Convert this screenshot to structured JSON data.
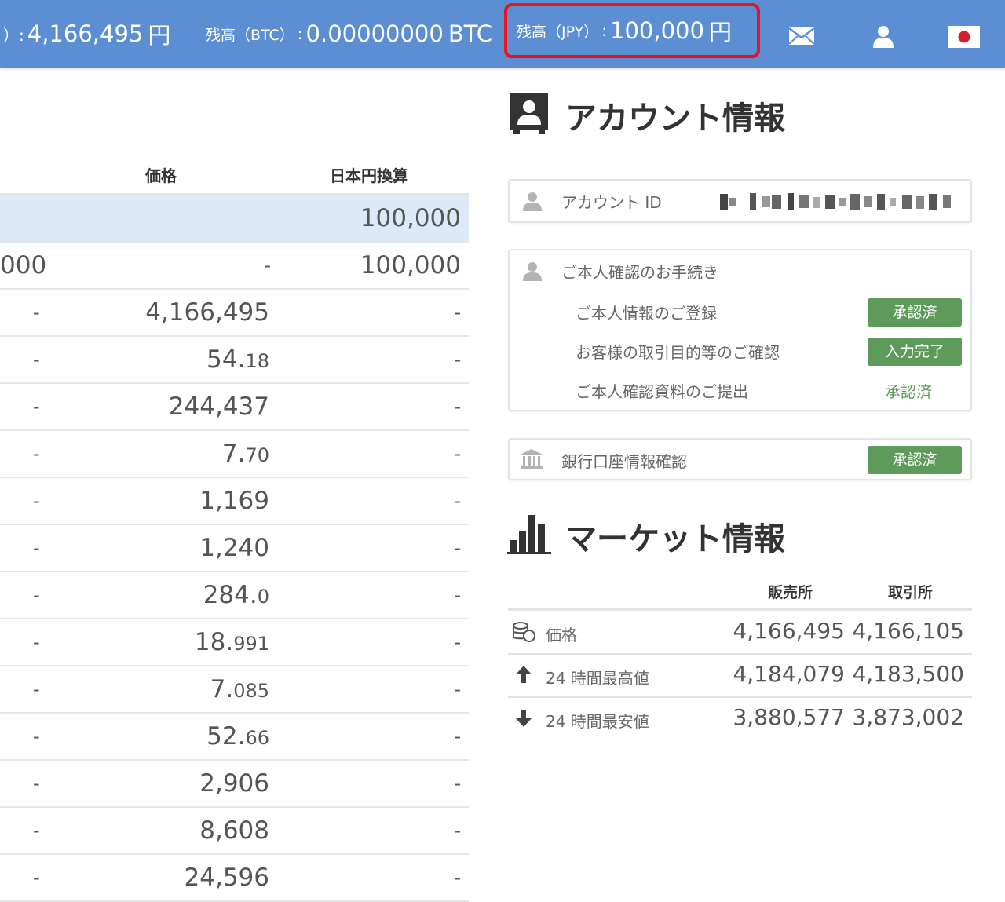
{
  "topbar": {
    "partial_prefix": "）:",
    "partial_value": "4,166,495",
    "partial_unit": "円",
    "btc_label": "残高（BTC）",
    "btc_sep": ":",
    "btc_value": "0.00000000",
    "btc_unit": "BTC",
    "jpy_label": "残高（JPY）",
    "jpy_sep": ":",
    "jpy_value": "100,000",
    "jpy_unit": "円",
    "icons": [
      "mail-icon",
      "user-icon",
      "japan-flag-icon"
    ],
    "highlight_color": "#e8131f",
    "bar_color": "#5b8ed3"
  },
  "table": {
    "headers": {
      "price": "価格",
      "jpy": "日本円換算"
    },
    "rows": [
      {
        "amount": "",
        "price": "",
        "jpy": "100,000"
      },
      {
        "amount": "000",
        "price": "-",
        "jpy": "100,000"
      },
      {
        "amount": "-",
        "price": "4,166,495",
        "jpy": "-"
      },
      {
        "amount": "-",
        "price_main": "54.",
        "price_small": "18",
        "jpy": "-"
      },
      {
        "amount": "-",
        "price": "244,437",
        "jpy": "-"
      },
      {
        "amount": "-",
        "price_main": "7.",
        "price_small": "70",
        "jpy": "-"
      },
      {
        "amount": "-",
        "price": "1,169",
        "jpy": "-"
      },
      {
        "amount": "-",
        "price": "1,240",
        "jpy": "-"
      },
      {
        "amount": "-",
        "price_main": "284.",
        "price_small": "0",
        "jpy": "-"
      },
      {
        "amount": "-",
        "price_main": "18.",
        "price_small": "991",
        "jpy": "-"
      },
      {
        "amount": "-",
        "price_main": "7.",
        "price_small": "085",
        "jpy": "-"
      },
      {
        "amount": "-",
        "price_main": "52.",
        "price_small": "66",
        "jpy": "-"
      },
      {
        "amount": "-",
        "price": "2,906",
        "jpy": "-"
      },
      {
        "amount": "-",
        "price": "8,608",
        "jpy": "-"
      },
      {
        "amount": "-",
        "price": "24,596",
        "jpy": "-"
      }
    ]
  },
  "account": {
    "title": "アカウント情報",
    "id_label": "アカウント ID",
    "identity": {
      "title": "ご本人確認のお手続き",
      "items": [
        {
          "label": "ご本人情報のご登録",
          "status": "承認済"
        },
        {
          "label": "お客様の取引目的等のご確認",
          "status": "入力完了"
        },
        {
          "label": "ご本人確認資料のご提出",
          "status": "承認済"
        }
      ]
    },
    "bank": {
      "label": "銀行口座情報確認",
      "status": "承認済"
    },
    "badge_color": "#5e9b5a"
  },
  "market": {
    "title": "マーケット情報",
    "col_sales": "販売所",
    "col_exchange": "取引所",
    "rows": [
      {
        "icon": "coins-icon",
        "label": "価格",
        "sales": "4,166,495",
        "exchange": "4,166,105"
      },
      {
        "icon": "arrow-up-icon",
        "label": "24 時間最高値",
        "sales": "4,184,079",
        "exchange": "4,183,500"
      },
      {
        "icon": "arrow-down-icon",
        "label": "24 時間最安値",
        "sales": "3,880,577",
        "exchange": "3,873,002"
      }
    ]
  }
}
